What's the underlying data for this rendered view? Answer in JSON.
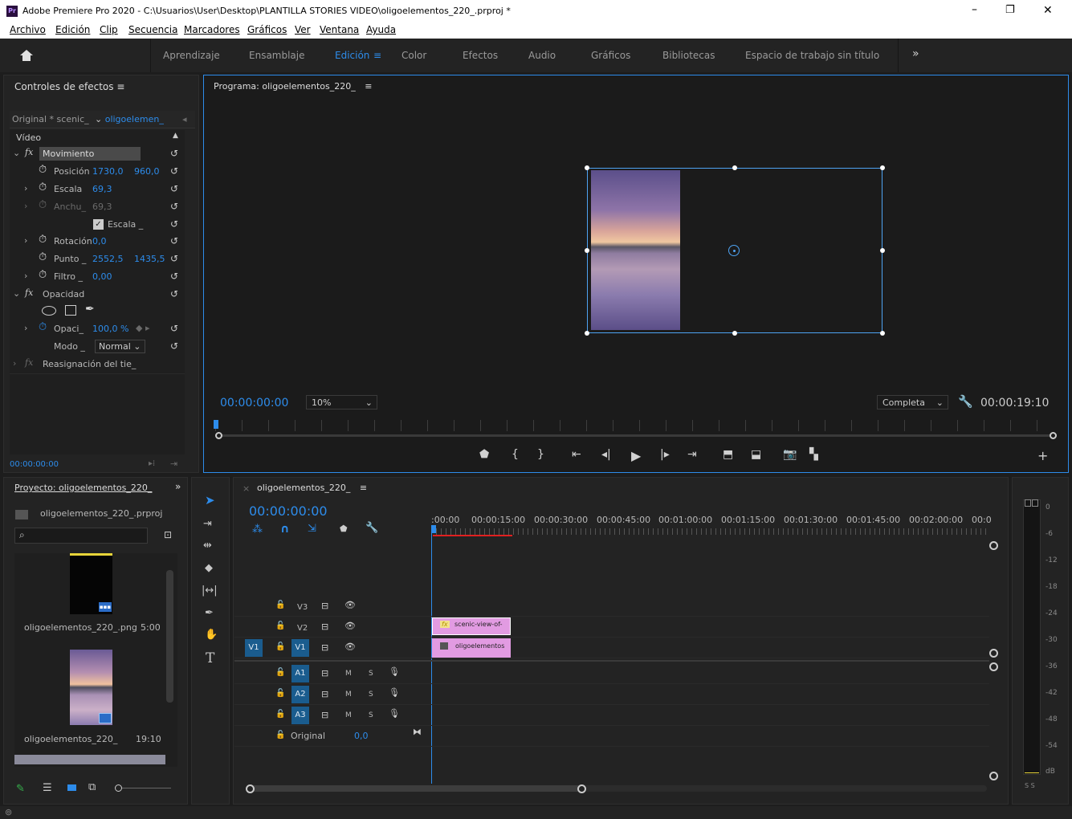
{
  "titlebar": {
    "app_icon": "Pr",
    "title": "Adobe Premiere Pro 2020 - C:\\Usuarios\\User\\Desktop\\PLANTILLA STORIES VIDEO\\oligoelementos_220_.prproj *",
    "minimize": "–",
    "restore": "❐",
    "close": "✕"
  },
  "menu": [
    "Archivo",
    "Edición",
    "Clip",
    "Secuencia",
    "Marcadores",
    "Gráficos",
    "Ver",
    "Ventana",
    "Ayuda"
  ],
  "workspaces": {
    "home_icon": "home-icon",
    "items": [
      "Aprendizaje",
      "Ensamblaje",
      "Edición",
      "Color",
      "Efectos",
      "Audio",
      "Gráficos",
      "Bibliotecas",
      "Espacio de trabajo sin título"
    ],
    "active": "Edición",
    "more": "»"
  },
  "effect_controls": {
    "title": "Controles de efectos",
    "menu_icon": "≡",
    "source": "Original * scenic_",
    "clip": "oligoelemen_",
    "section": "Vídeo",
    "movimiento": "Movimiento",
    "posicion_label": "Posición",
    "posicion_x": "1730,0",
    "posicion_y": "960,0",
    "escala_label": "Escala",
    "escala_val": "69,3",
    "anchura_label": "Anchu_",
    "anchura_val": "69,3",
    "escala_uniforme": "Escala _",
    "rotacion_label": "Rotación",
    "rotacion_val": "0,0",
    "punto_label": "Punto _",
    "punto_x": "2552,5",
    "punto_y": "1435,5",
    "filtro_label": "Filtro _",
    "filtro_val": "0,00",
    "opacidad": "Opacidad",
    "opaci_label": "Opaci_",
    "opaci_val": "100,0 %",
    "modo_label": "Modo _",
    "modo_val": "Normal",
    "reasignacion": "Reasignación del tie_",
    "timecode": "00:00:00:00"
  },
  "program": {
    "title": "Programa: oligoelementos_220_",
    "menu_icon": "≡",
    "timecode": "00:00:00:00",
    "zoom": "10%",
    "quality": "Completa",
    "duration": "00:00:19:10"
  },
  "project": {
    "title": "Proyecto: oligoelementos_220_",
    "more": "»",
    "file": "oligoelementos_220_.prproj",
    "items": [
      {
        "name": "oligoelementos_220_.png",
        "duration": "5:00"
      },
      {
        "name": "oligoelementos_220_",
        "duration": "19:10"
      }
    ]
  },
  "timeline": {
    "tab": "oligoelementos_220_",
    "close": "×",
    "menu_icon": "≡",
    "timecode": "00:00:00:00",
    "ruler": [
      ":00:00",
      "00:00:15:00",
      "00:00:30:00",
      "00:00:45:00",
      "00:01:00:00",
      "00:01:15:00",
      "00:01:30:00",
      "00:01:45:00",
      "00:02:00:00",
      "00:0"
    ],
    "video_tracks": [
      "V3",
      "V2",
      "V1"
    ],
    "audio_tracks": [
      "A1",
      "A2",
      "A3"
    ],
    "source_v": "V1",
    "m": "M",
    "s": "S",
    "original_label": "Original",
    "original_val": "0,0",
    "clip_v2": "scenic-view-of-",
    "clip_v2_fx": "fx",
    "clip_v1": "oligoelementos"
  },
  "meter": {
    "labels": [
      "0",
      "-6",
      "-12",
      "-18",
      "-24",
      "-30",
      "-36",
      "-42",
      "-48",
      "-54",
      "dB"
    ],
    "solo": "S S"
  },
  "colors": {
    "accent": "#2d8ceb",
    "clip": "#e08de0",
    "panel": "#232323",
    "bg": "#1d1d1d"
  }
}
